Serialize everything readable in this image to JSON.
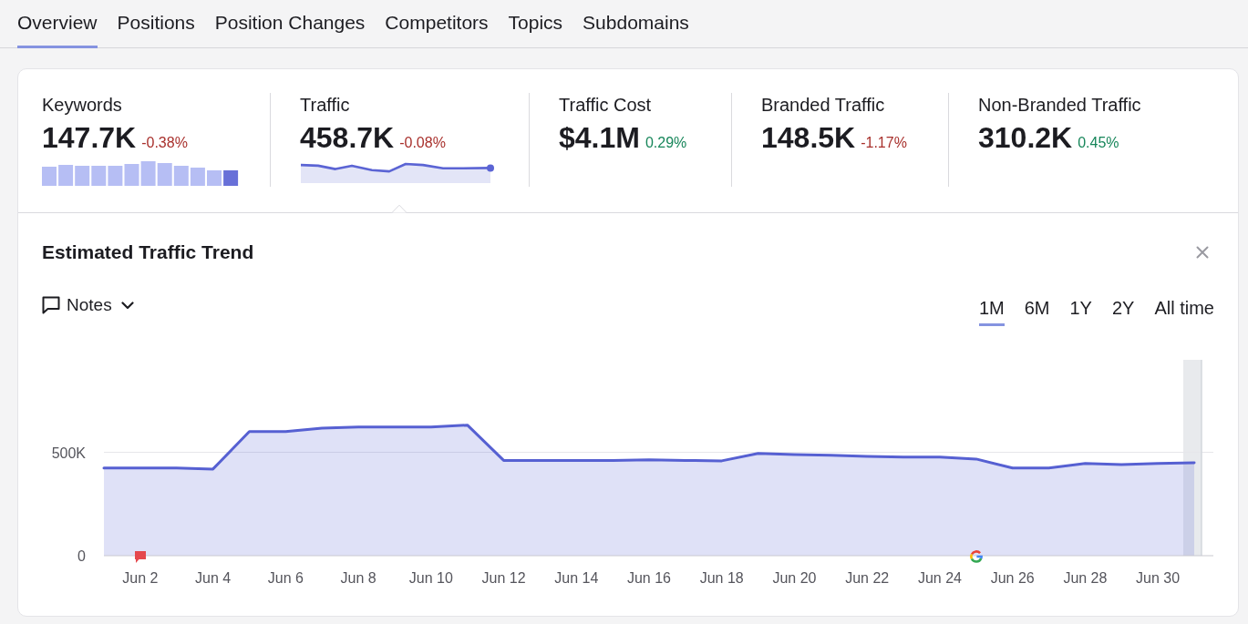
{
  "tabs": [
    {
      "label": "Overview",
      "selected": true
    },
    {
      "label": "Positions",
      "selected": false
    },
    {
      "label": "Position Changes",
      "selected": false
    },
    {
      "label": "Competitors",
      "selected": false
    },
    {
      "label": "Topics",
      "selected": false
    },
    {
      "label": "Subdomains",
      "selected": false
    }
  ],
  "metrics": [
    {
      "label": "Keywords",
      "value": "147.7K",
      "change": "-0.38%",
      "color": "#a8302c",
      "kind": "bars",
      "selected": false
    },
    {
      "label": "Traffic",
      "value": "458.7K",
      "change": "-0.08%",
      "color": "#a8302c",
      "kind": "sparkline",
      "selected": true
    },
    {
      "label": "Traffic Cost",
      "value": "$4.1M",
      "change": "0.29%",
      "color": "#17865a",
      "kind": "plain",
      "selected": false
    },
    {
      "label": "Branded Traffic",
      "value": "148.5K",
      "change": "-1.17%",
      "color": "#a8302c",
      "kind": "plain",
      "selected": false
    },
    {
      "label": "Non-Branded Traffic",
      "value": "310.2K",
      "change": "0.45%",
      "color": "#17865a",
      "kind": "plain",
      "selected": false
    }
  ],
  "trend": {
    "title": "Estimated Traffic Trend",
    "notes_button": "Notes",
    "periods": [
      {
        "label": "1M",
        "selected": true
      },
      {
        "label": "6M",
        "selected": false
      },
      {
        "label": "1Y",
        "selected": false
      },
      {
        "label": "2Y",
        "selected": false
      },
      {
        "label": "All time",
        "selected": false
      }
    ],
    "markers": [
      {
        "kind": "note"
      },
      {
        "kind": "update"
      }
    ],
    "chart_data": {
      "type": "area",
      "categories": [
        null,
        "Jun 2",
        null,
        "Jun 4",
        null,
        "Jun 6",
        null,
        "Jun 8",
        null,
        "Jun 10",
        null,
        "Jun 12",
        null,
        "Jun 14",
        null,
        "Jun 16",
        null,
        "Jun 18",
        null,
        "Jun 20",
        null,
        "Jun 22",
        null,
        "Jun 24",
        null,
        "Jun 26",
        null,
        "Jun 28",
        null,
        "Jun 30",
        null
      ],
      "values": [
        425000,
        425000,
        425000,
        420000,
        602000,
        602000,
        619000,
        624000,
        624000,
        624000,
        633000,
        462000,
        462000,
        462000,
        462000,
        465000,
        462000,
        460000,
        496000,
        491000,
        487000,
        482000,
        478000,
        478000,
        469000,
        425000,
        425000,
        447000,
        442000,
        447000,
        451000
      ],
      "ylim": [
        0,
        950000
      ],
      "yticks": [
        {
          "value": 0,
          "label": "0"
        },
        {
          "value": 500000,
          "label": "500K"
        }
      ]
    }
  }
}
